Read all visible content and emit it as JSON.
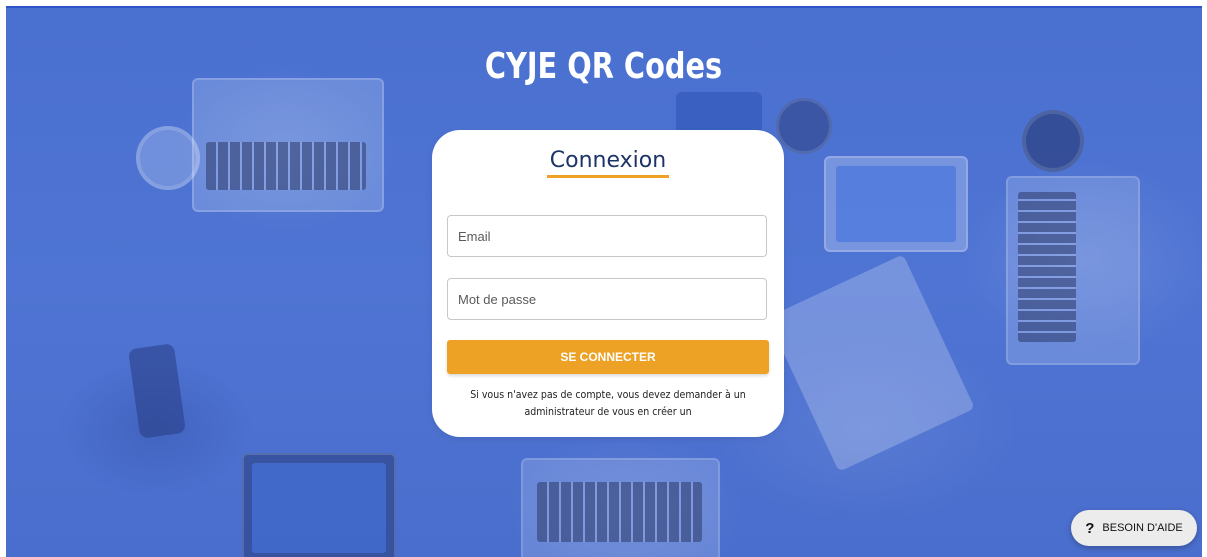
{
  "app": {
    "title": "CYJE QR Codes"
  },
  "login": {
    "heading": "Connexion",
    "email_placeholder": "Email",
    "password_placeholder": "Mot de passe",
    "submit_label": "SE CONNECTER",
    "note": "Si vous n'avez pas de compte, vous devez demander à un administrateur de vous en créer un"
  },
  "help": {
    "icon": "question-icon",
    "icon_glyph": "?",
    "label": "BESOIN D'AIDE"
  },
  "colors": {
    "background_overlay": "#4f74d3",
    "accent": "#eda226",
    "heading": "#1d3468"
  }
}
